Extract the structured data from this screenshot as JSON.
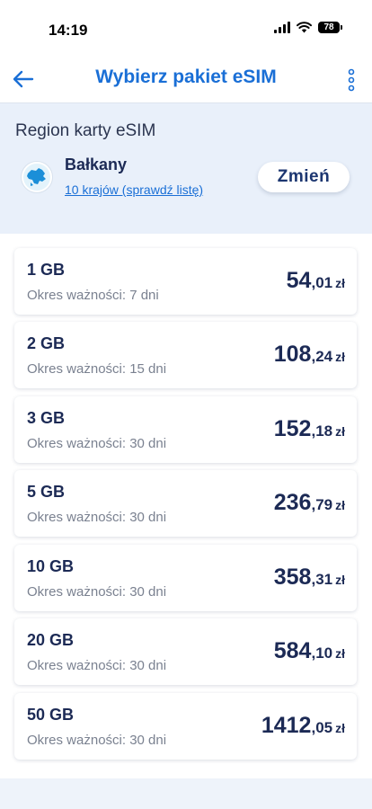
{
  "status_bar": {
    "time": "14:19",
    "battery": "78"
  },
  "header": {
    "title": "Wybierz pakiet eSIM"
  },
  "region": {
    "label": "Region karty eSIM",
    "name": "Bałkany",
    "countries_link": "10 krajów (sprawdź listę)",
    "change_button": "Zmień"
  },
  "colors": {
    "accent": "#1a6fd6",
    "text_dark": "#1c2a55",
    "background": "#eef3fa"
  },
  "packages": [
    {
      "size": "1 GB",
      "validity": "Okres ważności: 7 dni",
      "price_main": "54",
      "price_decimal": ",01",
      "currency": "zł"
    },
    {
      "size": "2 GB",
      "validity": "Okres ważności: 15 dni",
      "price_main": "108",
      "price_decimal": ",24",
      "currency": "zł"
    },
    {
      "size": "3 GB",
      "validity": "Okres ważności: 30 dni",
      "price_main": "152",
      "price_decimal": ",18",
      "currency": "zł"
    },
    {
      "size": "5 GB",
      "validity": "Okres ważności: 30 dni",
      "price_main": "236",
      "price_decimal": ",79",
      "currency": "zł"
    },
    {
      "size": "10 GB",
      "validity": "Okres ważności: 30 dni",
      "price_main": "358",
      "price_decimal": ",31",
      "currency": "zł"
    },
    {
      "size": "20 GB",
      "validity": "Okres ważności: 30 dni",
      "price_main": "584",
      "price_decimal": ",10",
      "currency": "zł"
    },
    {
      "size": "50 GB",
      "validity": "Okres ważności: 30 dni",
      "price_main": "1412",
      "price_decimal": ",05",
      "currency": "zł"
    }
  ]
}
